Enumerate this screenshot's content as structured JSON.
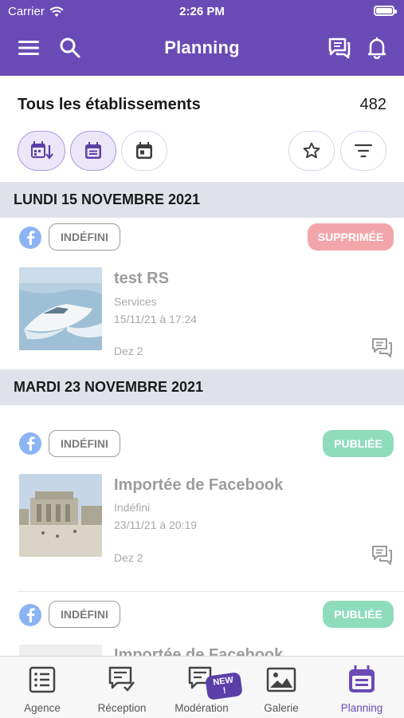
{
  "status": {
    "carrier": "Carrier",
    "time": "2:26 PM"
  },
  "header": {
    "title": "Planning"
  },
  "toolbar": {
    "scope": "Tous les établissements",
    "count": "482"
  },
  "sections": [
    {
      "date": "LUNDI 15 NOVEMBRE 2021",
      "post": {
        "tag": "INDÉFINI",
        "badge": "SUPPRIMÉE",
        "title": "test RS",
        "category": "Services",
        "datetime": "15/11/21 à 17:24",
        "author": "Dez 2"
      }
    },
    {
      "date": "MARDI 23 NOVEMBRE 2021",
      "post": {
        "tag": "INDÉFINI",
        "badge": "PUBLIÉE",
        "title": "Importée de Facebook",
        "category": "Indéfini",
        "datetime": "23/11/21 à 20:19",
        "author": "Dez 2"
      },
      "post2": {
        "tag": "INDÉFINI",
        "badge": "PUBLIÉE",
        "title": "Importée de Facebook"
      }
    }
  ],
  "tabs": [
    {
      "label": "Agence"
    },
    {
      "label": "Réception"
    },
    {
      "label": "Modération",
      "badge": "NEW !"
    },
    {
      "label": "Galerie"
    },
    {
      "label": "Planning"
    }
  ],
  "colors": {
    "brand": "#6a4bb6",
    "deleted": "#f3a6aa",
    "published": "#8fdcbd",
    "facebook": "#8cb4f3"
  }
}
